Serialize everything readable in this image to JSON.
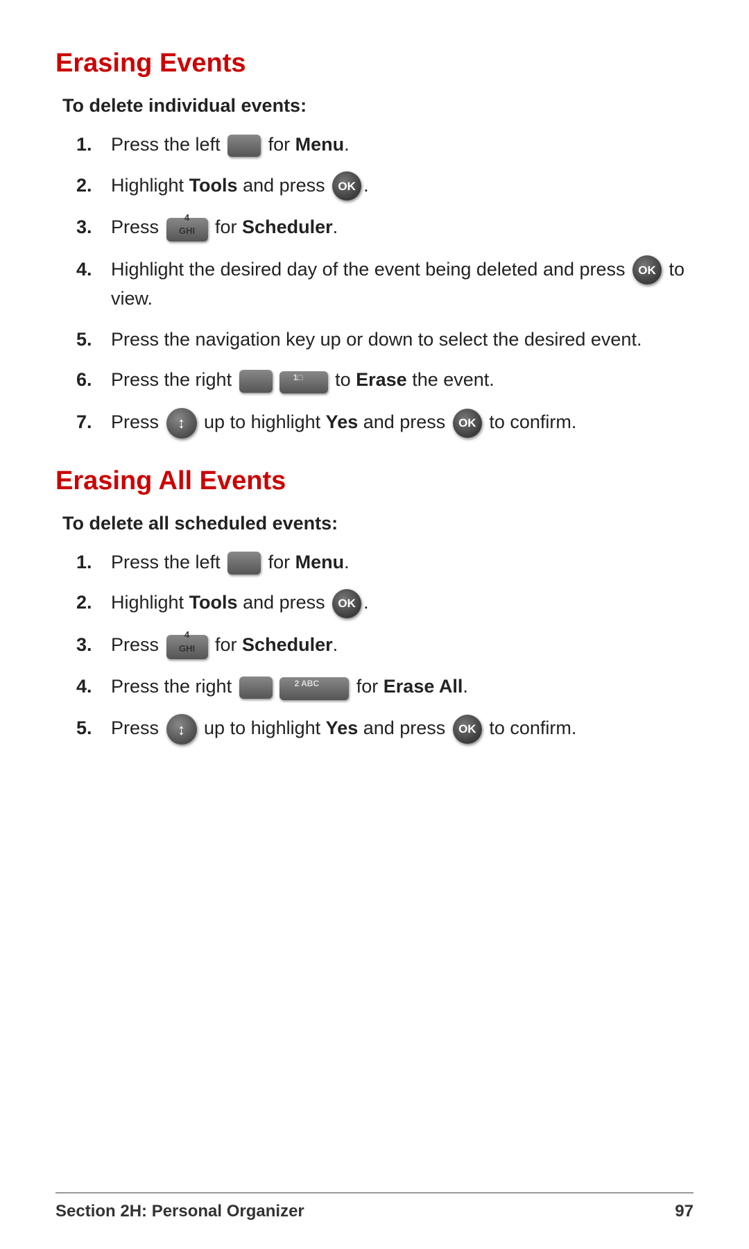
{
  "page": {
    "background": "#ffffff"
  },
  "section1": {
    "title": "Erasing Events",
    "subtitle": "To delete individual events:",
    "steps": [
      {
        "number": "1.",
        "text_before": "Press the left",
        "key_type": "left_soft",
        "text_after": "for",
        "bold_text": "Menu",
        "text_end": "."
      },
      {
        "number": "2.",
        "text_before": "Highlight",
        "bold_text": "Tools",
        "text_middle": "and press",
        "key_type": "ok",
        "text_after": "."
      },
      {
        "number": "3.",
        "text_before": "Press",
        "key_type": "4ghi",
        "text_after": "for",
        "bold_text": "Scheduler",
        "text_end": "."
      },
      {
        "number": "4.",
        "text_before": "Highlight the desired day of the event being deleted and press",
        "key_type": "ok_inline",
        "text_after": "to view."
      },
      {
        "number": "5.",
        "text_before": "Press the navigation key up or down to select the desired event."
      },
      {
        "number": "6.",
        "text_before": "Press the right",
        "key_type": "right_1m",
        "text_middle": "to",
        "bold_text": "Erase",
        "text_after": "the event."
      },
      {
        "number": "7.",
        "text_before": "Press",
        "key_type": "nav_up",
        "text_middle": "up to highlight",
        "bold_text": "Yes",
        "text_after": "and press",
        "key_type2": "ok",
        "text_end": "to confirm."
      }
    ]
  },
  "section2": {
    "title": "Erasing All Events",
    "subtitle": "To delete all scheduled events:",
    "steps": [
      {
        "number": "1.",
        "text_before": "Press the left",
        "key_type": "left_soft",
        "text_after": "for",
        "bold_text": "Menu",
        "text_end": "."
      },
      {
        "number": "2.",
        "text_before": "Highlight",
        "bold_text": "Tools",
        "text_middle": "and press",
        "key_type": "ok",
        "text_after": "."
      },
      {
        "number": "3.",
        "text_before": "Press",
        "key_type": "4ghi",
        "text_after": "for",
        "bold_text": "Scheduler",
        "text_end": "."
      },
      {
        "number": "4.",
        "text_before": "Press the right",
        "key_type": "right_2abc",
        "text_middle": "for",
        "bold_text": "Erase All",
        "text_end": "."
      },
      {
        "number": "5.",
        "text_before": "Press",
        "key_type": "nav_up",
        "text_middle": "up to highlight",
        "bold_text": "Yes",
        "text_after": "and press",
        "key_type2": "ok",
        "text_end": "to confirm."
      }
    ]
  },
  "footer": {
    "left": "Section 2H: Personal Organizer",
    "right": "97"
  }
}
